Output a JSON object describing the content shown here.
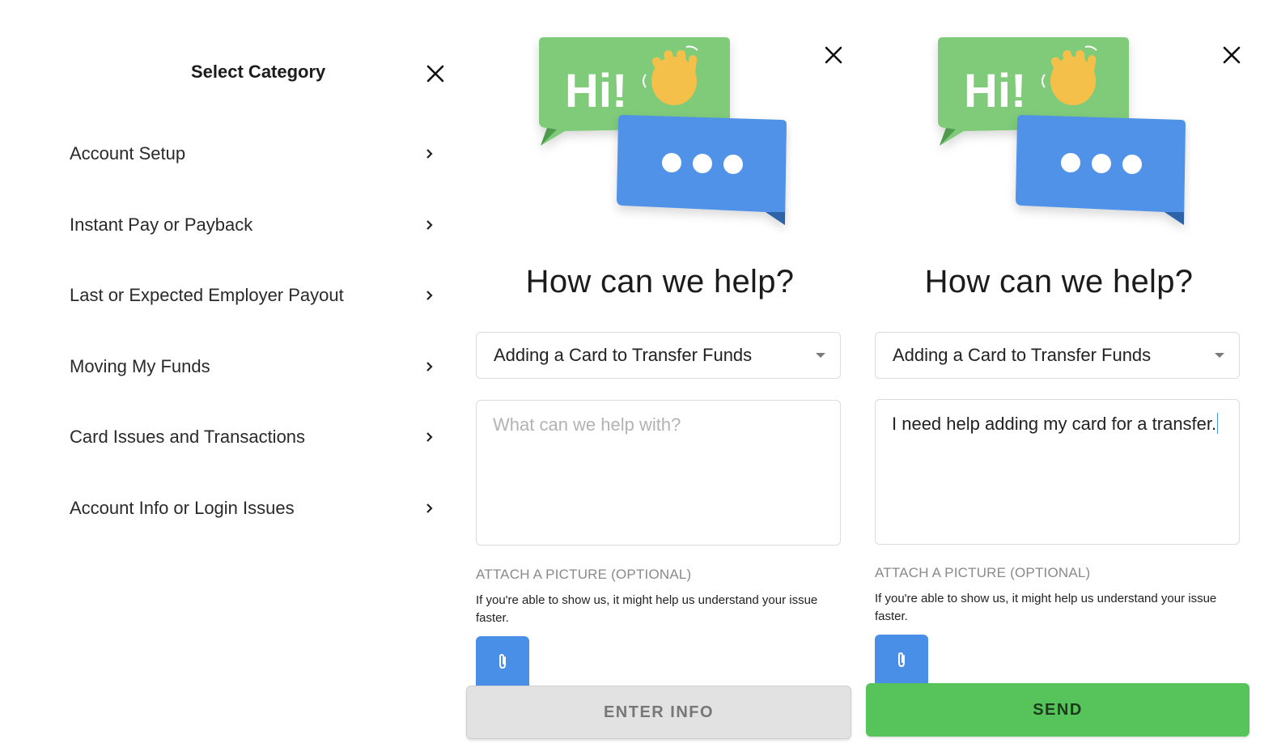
{
  "category_panel": {
    "title": "Select Category",
    "close_icon": "close-icon",
    "items": [
      {
        "label": "Account Setup"
      },
      {
        "label": "Instant Pay or Payback"
      },
      {
        "label": "Last or Expected Employer Payout"
      },
      {
        "label": "Moving My Funds"
      },
      {
        "label": "Card Issues and Transactions"
      },
      {
        "label": "Account Info or Login Issues"
      }
    ]
  },
  "help_form_empty": {
    "illustration": {
      "greeting": "Hi!"
    },
    "heading": "How can we help?",
    "category_select": {
      "value": "Adding a Card to Transfer Funds"
    },
    "message": {
      "placeholder": "What can we help with?",
      "value": ""
    },
    "attach": {
      "label": "ATTACH A PICTURE (OPTIONAL)",
      "help": "If you're able to show us, it might help us understand your issue faster.",
      "icon": "paperclip-icon"
    },
    "action_button": {
      "label": "ENTER INFO",
      "state": "disabled"
    }
  },
  "help_form_filled": {
    "illustration": {
      "greeting": "Hi!"
    },
    "heading": "How can we help?",
    "category_select": {
      "value": "Adding a Card to Transfer Funds"
    },
    "message": {
      "placeholder": "What can we help with?",
      "value": "I need help adding my card for a transfer."
    },
    "attach": {
      "label": "ATTACH A PICTURE (OPTIONAL)",
      "help": "If you're able to show us, it might help us understand your issue faster.",
      "icon": "paperclip-icon"
    },
    "action_button": {
      "label": "SEND",
      "state": "enabled"
    }
  },
  "colors": {
    "accent_blue": "#4a8fe7",
    "send_green": "#56c45a",
    "bubble_green": "#7fcb7a",
    "bubble_blue": "#5092e8",
    "disabled_gray": "#e2e2e2"
  }
}
